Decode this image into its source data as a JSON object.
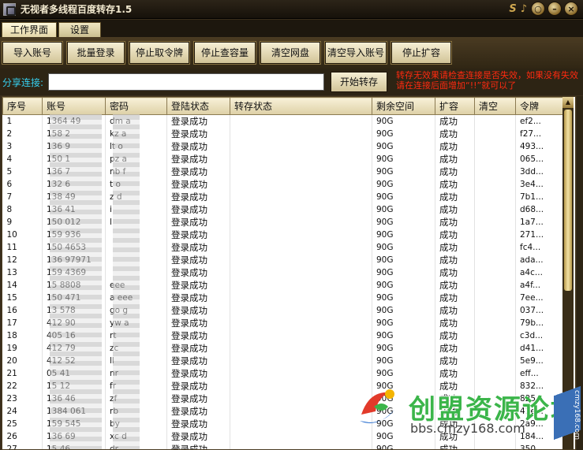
{
  "window": {
    "title": "无视者多线程百度转存1.5",
    "controls": [
      "S",
      "♪",
      "○",
      "–",
      "×"
    ]
  },
  "menu": {
    "tabs": [
      "工作界面",
      "设置"
    ]
  },
  "toolbar": {
    "buttons": [
      "导入账号",
      "批量登录",
      "停止取令牌",
      "停止查容量",
      "清空网盘",
      "清空导入账号",
      "停止扩容"
    ]
  },
  "share": {
    "label": "分享连接:",
    "input_value": "",
    "start_button": "开始转存",
    "notice": "转存无效果请检查连接是否失效，如果没有失效请在连接后面增加“!!”就可以了"
  },
  "colors": {
    "accent_cyan": "#36d0f0",
    "notice_red": "#ff2a10",
    "frame_brown": "#3a2e1c"
  },
  "table": {
    "columns": [
      "序号",
      "账号",
      "密码",
      "登陆状态",
      "转存状态",
      "剩余空间",
      "扩容",
      "清空",
      "令牌"
    ],
    "rows": [
      [
        "1",
        "1364 49",
        "dm a",
        "登录成功",
        "",
        "90G",
        "成功",
        "",
        "ef2..."
      ],
      [
        "2",
        "158 2",
        "kz a",
        "登录成功",
        "",
        "90G",
        "成功",
        "",
        "f27..."
      ],
      [
        "3",
        "136 9",
        "lt o",
        "登录成功",
        "",
        "90G",
        "成功",
        "",
        "493..."
      ],
      [
        "4",
        "150 1",
        "pz a",
        "登录成功",
        "",
        "90G",
        "成功",
        "",
        "065..."
      ],
      [
        "5",
        "136 7",
        "nb f",
        "登录成功",
        "",
        "90G",
        "成功",
        "",
        "3dd..."
      ],
      [
        "6",
        "132 6",
        "t o",
        "登录成功",
        "",
        "90G",
        "成功",
        "",
        "3e4..."
      ],
      [
        "7",
        "138 49",
        "z d",
        "登录成功",
        "",
        "90G",
        "成功",
        "",
        "7b1..."
      ],
      [
        "8",
        "136 41",
        "i",
        "登录成功",
        "",
        "90G",
        "成功",
        "",
        "d68..."
      ],
      [
        "9",
        "150 012",
        "l",
        "登录成功",
        "",
        "90G",
        "成功",
        "",
        "1a7..."
      ],
      [
        "10",
        "159 936",
        "",
        "登录成功",
        "",
        "90G",
        "成功",
        "",
        "271..."
      ],
      [
        "11",
        "150 4653",
        "",
        "登录成功",
        "",
        "90G",
        "成功",
        "",
        "fc4..."
      ],
      [
        "12",
        "136 97971",
        "",
        "登录成功",
        "",
        "90G",
        "成功",
        "",
        "ada..."
      ],
      [
        "13",
        "159 4369",
        "",
        "登录成功",
        "",
        "90G",
        "成功",
        "",
        "a4c..."
      ],
      [
        "14",
        "15 8808",
        "eee",
        "登录成功",
        "",
        "90G",
        "成功",
        "",
        "a4f..."
      ],
      [
        "15",
        "150 471",
        "a eee",
        "登录成功",
        "",
        "90G",
        "成功",
        "",
        "7ee..."
      ],
      [
        "16",
        "13 578",
        "go g",
        "登录成功",
        "",
        "90G",
        "成功",
        "",
        "037..."
      ],
      [
        "17",
        "412 90",
        "yw a",
        "登录成功",
        "",
        "90G",
        "成功",
        "",
        "79b..."
      ],
      [
        "18",
        "405 16",
        "rt",
        "登录成功",
        "",
        "90G",
        "成功",
        "",
        "c3d..."
      ],
      [
        "19",
        "412 79",
        "zc",
        "登录成功",
        "",
        "90G",
        "成功",
        "",
        "d41..."
      ],
      [
        "20",
        "412 52",
        "ll",
        "登录成功",
        "",
        "90G",
        "成功",
        "",
        "5e9..."
      ],
      [
        "21",
        "05 41",
        "nr",
        "登录成功",
        "",
        "90G",
        "成功",
        "",
        "eff..."
      ],
      [
        "22",
        "15 12",
        "fr",
        "登录成功",
        "",
        "90G",
        "成功",
        "",
        "832..."
      ],
      [
        "23",
        "136 46",
        "zf",
        "登录成功",
        "",
        "90G",
        "成功",
        "",
        "825..."
      ],
      [
        "24",
        "1384 061",
        "rb",
        "登录成功",
        "",
        "90G",
        "成功",
        "",
        "41e..."
      ],
      [
        "25",
        "159 545",
        "by",
        "登录成功",
        "",
        "90G",
        "成功",
        "",
        "2a9..."
      ],
      [
        "26",
        "136 69",
        "xc d",
        "登录成功",
        "",
        "90G",
        "成功",
        "",
        "184..."
      ],
      [
        "27",
        "15 46",
        "dr",
        "登录成功",
        "",
        "90G",
        "成功",
        "",
        "350..."
      ]
    ]
  },
  "watermark": {
    "title": "创盟资源论坛",
    "url": "bbs.cmzy168.com",
    "corner": "cmzy168.com"
  }
}
